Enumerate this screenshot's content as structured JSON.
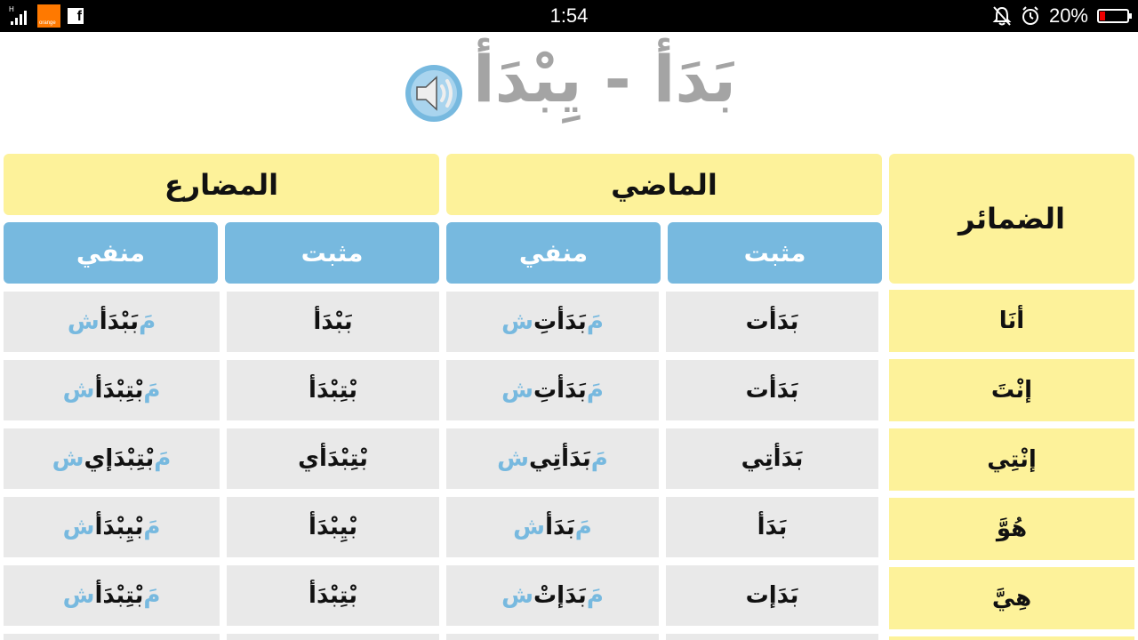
{
  "status_bar": {
    "network_label": "H",
    "carrier_label": "orange",
    "time": "1:54",
    "battery_percent": "20%",
    "battery_level": 0.2,
    "icons": [
      "signal-icon",
      "orange-logo-icon",
      "facebook-icon",
      "mute-icon",
      "alarm-icon",
      "battery-icon"
    ]
  },
  "verb_title": "بَدَأ - يِبْدَأ",
  "table": {
    "pronouns_header": "الضمائر",
    "past_header": "الماضي",
    "present_header": "المضارع",
    "affirmative_label": "مثبت",
    "negative_label": "منفي",
    "negation_prefix": "مَ",
    "negation_suffix": "ش",
    "rows": [
      {
        "pronoun": "أنَا",
        "past_aff": "بَدَأت",
        "past_neg": "بَدَأتِ",
        "pres_aff": "بَبْدَأ",
        "pres_neg": "بَبْدَأ"
      },
      {
        "pronoun": "إنْتَ",
        "past_aff": "بَدَأت",
        "past_neg": "بَدَأتِ",
        "pres_aff": "بْتِبْدَأ",
        "pres_neg": "بْتِبْدَأ"
      },
      {
        "pronoun": "إنْتِي",
        "past_aff": "بَدَأتِي",
        "past_neg": "بَدَأتِي",
        "pres_aff": "بْتِبْدَأي",
        "pres_neg": "بْتِبْدَإي"
      },
      {
        "pronoun": "هُوَّ",
        "past_aff": "بَدَأ",
        "past_neg": "بَدَأ",
        "pres_aff": "بْيِبْدَأ",
        "pres_neg": "بْيِبْدَأ"
      },
      {
        "pronoun": "هِيَّ",
        "past_aff": "بَدَإت",
        "past_neg": "بَدَإتْ",
        "pres_aff": "بْتِبْدَأ",
        "pres_neg": "بْتِبْدَأ"
      }
    ]
  },
  "colors": {
    "header_yellow": "#fdf29a",
    "subheader_blue": "#77b9df",
    "cell_gray": "#e9e9e9",
    "title_gray": "#a4a4a4",
    "negation_blue": "#77b9df"
  }
}
